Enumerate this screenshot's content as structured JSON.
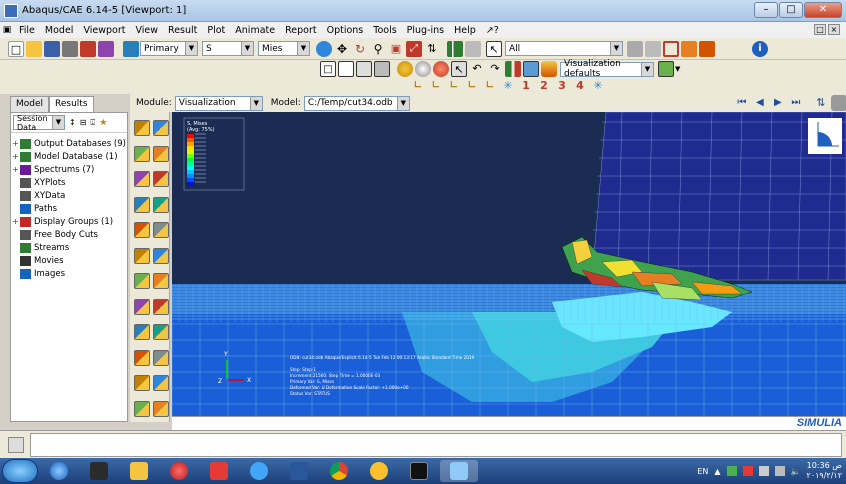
{
  "window": {
    "title": "Abaqus/CAE 6.14-5 [Viewport: 1]"
  },
  "menu": [
    "File",
    "Model",
    "Viewport",
    "View",
    "Result",
    "Plot",
    "Animate",
    "Report",
    "Options",
    "Tools",
    "Plug-ins",
    "Help",
    "⁄?"
  ],
  "toolbar": {
    "step_select": "Primary",
    "var_select": "S",
    "invariant_select": "Mies",
    "filter_select": "All",
    "view_select": "Visualization defaults",
    "frame_numbers": [
      "1",
      "2",
      "3",
      "4"
    ]
  },
  "module_bar": {
    "module_label": "Module:",
    "module_value": "Visualization",
    "model_label": "Model:",
    "model_value": "C:/Temp/cut34.odb"
  },
  "tabs": [
    {
      "label": "Model",
      "active": false
    },
    {
      "label": "Results",
      "active": true
    }
  ],
  "tree": {
    "session_label": "Session Data",
    "items": [
      {
        "label": "Output Databases (9)",
        "expand": "+",
        "icon": "database-icon",
        "color": "#2e7d32"
      },
      {
        "label": "Model Database (1)",
        "expand": "+",
        "icon": "database-icon",
        "color": "#2e7d32"
      },
      {
        "label": "Spectrums (7)",
        "expand": "+",
        "icon": "spectrum-icon",
        "color": "#6a1b9a"
      },
      {
        "label": "XYPlots",
        "expand": "",
        "icon": "grid-icon",
        "color": "#555555"
      },
      {
        "label": "XYData",
        "expand": "",
        "icon": "grid-icon",
        "color": "#555555"
      },
      {
        "label": "Paths",
        "expand": "",
        "icon": "path-icon",
        "color": "#1565c0"
      },
      {
        "label": "Display Groups (1)",
        "expand": "+",
        "icon": "display-group-icon",
        "color": "#c62828"
      },
      {
        "label": "Free Body Cuts",
        "expand": "",
        "icon": "cut-icon",
        "color": "#555555"
      },
      {
        "label": "Streams",
        "expand": "",
        "icon": "stream-icon",
        "color": "#2e7d32"
      },
      {
        "label": "Movies",
        "expand": "",
        "icon": "movie-icon",
        "color": "#333333"
      },
      {
        "label": "Images",
        "expand": "",
        "icon": "image-icon",
        "color": "#1565c0"
      }
    ]
  },
  "legend": {
    "title": "S, Mises",
    "subtitle": "(Avg: 75%)",
    "colors": [
      "#ff0000",
      "#ff5a00",
      "#ffa000",
      "#ffdc00",
      "#d4ff00",
      "#80ff00",
      "#00ff40",
      "#00ff9c",
      "#00ffe8",
      "#00c8ff",
      "#0090ff",
      "#0050ff",
      "#0010e0"
    ]
  },
  "viewport": {
    "info_lines": [
      "ODB: cut34.odb    Abaqus/Explicit 6.14-5    Tue Feb 12 00:13:17 Arabic Standard Time 2019",
      "",
      "Step: Step-1",
      "Increment     21560: Step Time =    1.0000E-03",
      "Primary Var: S, Mises",
      "Deformed Var: U   Deformation Scale Factor: +1.000e+00",
      "Status Var: STATUS"
    ],
    "axis_labels": {
      "x": "X",
      "y": "Y",
      "z": "Z"
    },
    "brand": "SIMULIA"
  },
  "taskbar": {
    "lang": "EN",
    "time": "10:36 ‫ص‬",
    "date": "٢٠١٩/٢/١٢"
  },
  "chart_data": {
    "type": "heatmap",
    "title": "S, Mises",
    "subtitle": "(Avg: 75%)",
    "legend_bands": 13
  }
}
